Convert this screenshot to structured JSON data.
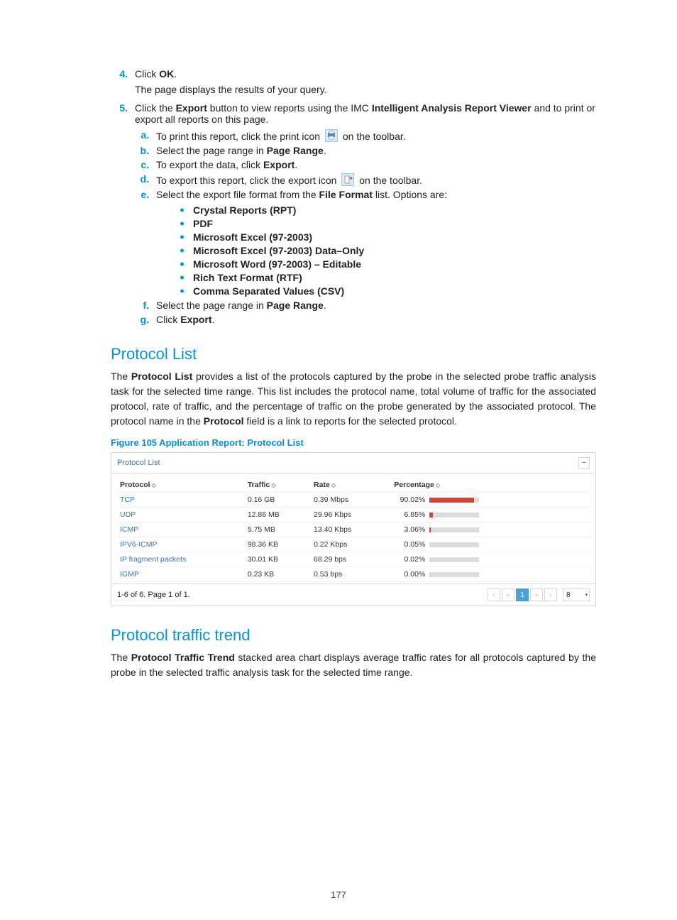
{
  "page_number": "177",
  "steps": {
    "step4_marker": "4.",
    "step4_text_a": "Click ",
    "step4_bold": "OK",
    "step4_text_b": ".",
    "step4_sub": "The page displays the results of your query.",
    "step5_marker": "5.",
    "step5_a": "Click the ",
    "step5_b_bold": "Export",
    "step5_c": " button to view reports using the IMC ",
    "step5_d_bold": "Intelligent Analysis Report Viewer",
    "step5_e": " and to print or export all reports on this page.",
    "sa": {
      "marker": "a.",
      "a": "To print this report, click the print icon ",
      "b": " on the toolbar."
    },
    "sb": {
      "marker": "b.",
      "a": "Select the page range in ",
      "b_bold": "Page Range",
      "c": "."
    },
    "sc": {
      "marker": "c.",
      "a": "To export the data, click ",
      "b_bold": "Export",
      "c": "."
    },
    "sd": {
      "marker": "d.",
      "a": "To export this report, click the export icon ",
      "b": " on the toolbar."
    },
    "se": {
      "marker": "e.",
      "a": "Select the export file format from the ",
      "b_bold": "File Format",
      "c": " list. Options are:"
    },
    "formats": [
      "Crystal Reports (RPT)",
      "PDF",
      "Microsoft Excel (97-2003)",
      "Microsoft Excel (97-2003) Data–Only",
      "Microsoft Word (97-2003) – Editable",
      "Rich Text Format (RTF)",
      "Comma Separated Values (CSV)"
    ],
    "sf": {
      "marker": "f.",
      "a": "Select the page range in ",
      "b_bold": "Page Range",
      "c": "."
    },
    "sg": {
      "marker": "g.",
      "a": "Click ",
      "b_bold": "Export",
      "c": "."
    }
  },
  "section1_title": "Protocol List",
  "section1_body_a": "The ",
  "section1_body_b_bold": "Protocol List",
  "section1_body_c": " provides a list of the protocols captured by the probe in the selected probe traffic analysis task for the selected time range. This list includes the protocol name, total volume of traffic for the associated protocol, rate of traffic, and the percentage of traffic on the probe generated by the associated protocol. The protocol name in the ",
  "section1_body_d_bold": "Protocol",
  "section1_body_e": " field is a link to reports for the selected protocol.",
  "fig_caption": "Figure 105 Application Report: Protocol List",
  "pl": {
    "title": "Protocol List",
    "collapse": "−",
    "headers": {
      "protocol": "Protocol",
      "traffic": "Traffic",
      "rate": "Rate",
      "pct": "Percentage"
    },
    "rows": [
      {
        "protocol": "TCP",
        "traffic": "0.16 GB",
        "rate": "0.39 Mbps",
        "pct": "90.02%"
      },
      {
        "protocol": "UDP",
        "traffic": "12.86 MB",
        "rate": "29.96 Kbps",
        "pct": "6.85%"
      },
      {
        "protocol": "ICMP",
        "traffic": "5.75 MB",
        "rate": "13.40 Kbps",
        "pct": "3.06%"
      },
      {
        "protocol": "IPV6-ICMP",
        "traffic": "98.36 KB",
        "rate": "0.22 Kbps",
        "pct": "0.05%"
      },
      {
        "protocol": "IP fragment packets",
        "traffic": "30.01 KB",
        "rate": "68.29 bps",
        "pct": "0.02%"
      },
      {
        "protocol": "IGMP",
        "traffic": "0.23 KB",
        "rate": "0.53 bps",
        "pct": "0.00%"
      }
    ],
    "foot_text": "1-6 of 6. Page 1 of 1.",
    "page_active": "1",
    "page_size": "8",
    "btn_first": "‹",
    "btn_prev": "«",
    "btn_next": "»",
    "btn_last": "›"
  },
  "section2_title": "Protocol traffic trend",
  "section2_body_a": "The ",
  "section2_body_b_bold": "Protocol Traffic Trend",
  "section2_body_c": " stacked area chart displays average traffic rates for all protocols captured by the probe in the selected traffic analysis task for the selected time range.",
  "chart_data": {
    "type": "table",
    "title": "Application Report: Protocol List",
    "columns": [
      "Protocol",
      "Traffic",
      "Rate",
      "Percentage"
    ],
    "rows": [
      [
        "TCP",
        "0.16 GB",
        "0.39 Mbps",
        90.02
      ],
      [
        "UDP",
        "12.86 MB",
        "29.96 Kbps",
        6.85
      ],
      [
        "ICMP",
        "5.75 MB",
        "13.40 Kbps",
        3.06
      ],
      [
        "IPV6-ICMP",
        "98.36 KB",
        "0.22 Kbps",
        0.05
      ],
      [
        "IP fragment packets",
        "30.01 KB",
        "68.29 bps",
        0.02
      ],
      [
        "IGMP",
        "0.23 KB",
        "0.53 bps",
        0.0
      ]
    ]
  }
}
